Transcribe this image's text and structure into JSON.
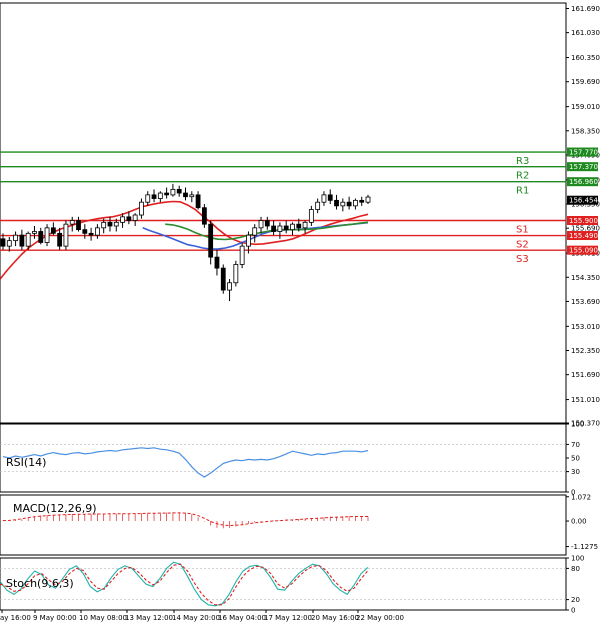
{
  "chart_data": [
    {
      "type": "candlestick",
      "panel": "price",
      "ylim": [
        150.37,
        161.84
      ],
      "y_ticks": [
        "161.690",
        "161.030",
        "160.350",
        "159.690",
        "159.010",
        "158.350",
        "157.690",
        "157.010",
        "156.350",
        "155.690",
        "155.010",
        "154.350",
        "153.690",
        "153.010",
        "152.350",
        "151.690",
        "151.010",
        "150.370"
      ],
      "current_price": 156.454,
      "current_price_label": "156.454",
      "candles": [
        [
          155.4,
          155.55,
          155.1,
          155.2
        ],
        [
          155.2,
          155.45,
          155.05,
          155.35
        ],
        [
          155.35,
          155.6,
          155.2,
          155.5
        ],
        [
          155.5,
          155.65,
          155.1,
          155.2
        ],
        [
          155.2,
          155.6,
          155.1,
          155.55
        ],
        [
          155.55,
          155.75,
          155.4,
          155.6
        ],
        [
          155.6,
          155.7,
          155.25,
          155.3
        ],
        [
          155.3,
          155.8,
          155.2,
          155.7
        ],
        [
          155.7,
          155.85,
          155.5,
          155.55
        ],
        [
          155.55,
          155.7,
          155.1,
          155.2
        ],
        [
          155.2,
          155.9,
          155.1,
          155.8
        ],
        [
          155.8,
          156.0,
          155.6,
          155.9
        ],
        [
          155.9,
          156.0,
          155.6,
          155.65
        ],
        [
          155.65,
          155.8,
          155.4,
          155.55
        ],
        [
          155.55,
          155.7,
          155.35,
          155.5
        ],
        [
          155.5,
          155.8,
          155.4,
          155.7
        ],
        [
          155.7,
          155.95,
          155.55,
          155.85
        ],
        [
          155.85,
          156.0,
          155.6,
          155.75
        ],
        [
          155.75,
          155.95,
          155.6,
          155.85
        ],
        [
          155.85,
          156.1,
          155.7,
          156.0
        ],
        [
          156.0,
          156.15,
          155.8,
          155.9
        ],
        [
          155.9,
          156.1,
          155.75,
          156.05
        ],
        [
          156.05,
          156.5,
          155.95,
          156.4
        ],
        [
          156.4,
          156.7,
          156.3,
          156.6
        ],
        [
          156.6,
          156.75,
          156.4,
          156.5
        ],
        [
          156.5,
          156.7,
          156.4,
          156.65
        ],
        [
          156.65,
          156.8,
          156.5,
          156.6
        ],
        [
          156.6,
          156.9,
          156.55,
          156.75
        ],
        [
          156.75,
          156.85,
          156.55,
          156.65
        ],
        [
          156.65,
          156.8,
          156.45,
          156.55
        ],
        [
          156.55,
          156.7,
          156.4,
          156.6
        ],
        [
          156.6,
          156.7,
          156.2,
          156.25
        ],
        [
          156.25,
          156.35,
          155.7,
          155.8
        ],
        [
          155.8,
          155.9,
          154.7,
          154.9
        ],
        [
          154.9,
          155.1,
          154.4,
          154.6
        ],
        [
          154.6,
          154.7,
          153.9,
          154.0
        ],
        [
          154.0,
          154.3,
          153.7,
          154.2
        ],
        [
          154.2,
          154.8,
          154.1,
          154.7
        ],
        [
          154.7,
          155.3,
          154.6,
          155.2
        ],
        [
          155.2,
          155.6,
          155.0,
          155.5
        ],
        [
          155.5,
          155.8,
          155.3,
          155.7
        ],
        [
          155.7,
          156.0,
          155.55,
          155.9
        ],
        [
          155.9,
          156.0,
          155.65,
          155.75
        ],
        [
          155.75,
          155.9,
          155.5,
          155.6
        ],
        [
          155.6,
          155.85,
          155.4,
          155.75
        ],
        [
          155.75,
          155.9,
          155.55,
          155.65
        ],
        [
          155.65,
          155.85,
          155.5,
          155.8
        ],
        [
          155.8,
          155.95,
          155.6,
          155.7
        ],
        [
          155.7,
          155.9,
          155.55,
          155.85
        ],
        [
          155.85,
          156.3,
          155.75,
          156.2
        ],
        [
          156.2,
          156.5,
          156.1,
          156.4
        ],
        [
          156.4,
          156.7,
          156.3,
          156.6
        ],
        [
          156.6,
          156.75,
          156.35,
          156.45
        ],
        [
          156.45,
          156.6,
          156.2,
          156.3
        ],
        [
          156.3,
          156.5,
          156.15,
          156.4
        ],
        [
          156.4,
          156.55,
          156.2,
          156.3
        ],
        [
          156.3,
          156.5,
          156.2,
          156.45
        ],
        [
          156.45,
          156.55,
          156.3,
          156.4
        ],
        [
          156.4,
          156.6,
          156.35,
          156.54
        ]
      ],
      "levels": [
        {
          "name": "R3",
          "value": 157.77,
          "label": "157.770",
          "color": "#1f8a1f"
        },
        {
          "name": "R2",
          "value": 157.37,
          "label": "157.370",
          "color": "#1f8a1f"
        },
        {
          "name": "R1",
          "value": 156.96,
          "label": "156.960",
          "color": "#1f8a1f"
        },
        {
          "name": "S1",
          "value": 155.9,
          "label": "155.900",
          "color": "#e02020"
        },
        {
          "name": "S2",
          "value": 155.49,
          "label": "155.490",
          "color": "#e02020"
        },
        {
          "name": "S3",
          "value": 155.09,
          "label": "155.090",
          "color": "#e02020"
        }
      ],
      "moving_averages": [
        {
          "color": "#e02020",
          "values": [
            154.3,
            154.55,
            154.78,
            155.0,
            155.18,
            155.33,
            155.46,
            155.57,
            155.66,
            155.73,
            155.8,
            155.86,
            155.91,
            155.95,
            155.98,
            156.0,
            156.05,
            156.12,
            156.2,
            156.28,
            156.33,
            156.37,
            156.4,
            156.42,
            156.41,
            156.32,
            156.2,
            156.02,
            155.86,
            155.67,
            155.51,
            155.39,
            155.31,
            155.27,
            155.25,
            155.26,
            155.29,
            155.32,
            155.35,
            155.4,
            155.48,
            155.57,
            155.66,
            155.73,
            155.8,
            155.86,
            155.91,
            155.96,
            156.02,
            156.07
          ]
        },
        {
          "color": "#3a5fd6",
          "values": [
            155.7,
            155.62,
            155.55,
            155.48,
            155.4,
            155.32,
            155.24,
            155.2,
            155.15,
            155.12,
            155.12,
            155.15,
            155.2,
            155.28,
            155.36,
            155.45,
            155.54,
            155.6,
            155.63,
            155.64,
            155.65,
            155.66,
            155.68,
            155.7,
            155.72,
            155.74,
            155.76,
            155.78,
            155.8,
            155.82,
            155.84
          ]
        },
        {
          "color": "#2e8b2e",
          "values": [
            155.8,
            155.78,
            155.73,
            155.66,
            155.57,
            155.49,
            155.43,
            155.39,
            155.38,
            155.4,
            155.44,
            155.49,
            155.54,
            155.58,
            155.62,
            155.64,
            155.65,
            155.65,
            155.65,
            155.66,
            155.67,
            155.69,
            155.72,
            155.75,
            155.78,
            155.8,
            155.83,
            155.85
          ]
        }
      ]
    },
    {
      "type": "line",
      "panel": "rsi",
      "title": "RSI(14)",
      "ylim": [
        0,
        100
      ],
      "y_ticks": [
        "100",
        "70",
        "50",
        "30",
        "0"
      ],
      "y_tick_values": [
        100,
        70,
        50,
        30,
        0
      ],
      "series": [
        {
          "color": "#4a90e2",
          "values": [
            52,
            50,
            53,
            51,
            53,
            55,
            53,
            56,
            58,
            56,
            55,
            57,
            58,
            56,
            57,
            59,
            60,
            61,
            60,
            62,
            63,
            64,
            65,
            64,
            65,
            63,
            62,
            60,
            57,
            48,
            37,
            28,
            22,
            28,
            35,
            42,
            45,
            47,
            46,
            48,
            47,
            48,
            47,
            49,
            52,
            56,
            60,
            58,
            56,
            54,
            56,
            55,
            57,
            58,
            60,
            60,
            60,
            59,
            61
          ]
        }
      ]
    },
    {
      "type": "macd",
      "panel": "macd",
      "title": "MACD(12,26,9)",
      "ylim": [
        -1.5,
        1.15
      ],
      "y_ticks": [
        "1.072",
        "0.00",
        "-1.1275"
      ],
      "y_tick_values": [
        1.072,
        0,
        -1.1275
      ],
      "histogram": [
        0.02,
        0.02,
        0.04,
        0.08,
        0.14,
        0.2,
        0.24,
        0.26,
        0.28,
        0.29,
        0.3,
        0.31,
        0.31,
        0.31,
        0.32,
        0.32,
        0.32,
        0.32,
        0.32,
        0.33,
        0.33,
        0.34,
        0.35,
        0.36,
        0.36,
        0.37,
        0.37,
        0.38,
        0.38,
        0.36,
        0.3,
        0.16,
        -0.02,
        -0.2,
        -0.3,
        -0.32,
        -0.3,
        -0.24,
        -0.18,
        -0.12,
        -0.06,
        -0.03,
        -0.01,
        0.01,
        0.03,
        0.05,
        0.07,
        0.09,
        0.11,
        0.13,
        0.15,
        0.17,
        0.19,
        0.2,
        0.21,
        0.22,
        0.22,
        0.21,
        0.2
      ],
      "signal": [
        0.02,
        0.03,
        0.06,
        0.1,
        0.15,
        0.19,
        0.22,
        0.24,
        0.26,
        0.27,
        0.28,
        0.29,
        0.3,
        0.3,
        0.31,
        0.31,
        0.31,
        0.32,
        0.32,
        0.32,
        0.32,
        0.33,
        0.33,
        0.34,
        0.34,
        0.35,
        0.35,
        0.36,
        0.36,
        0.35,
        0.32,
        0.24,
        0.12,
        -0.02,
        -0.12,
        -0.18,
        -0.2,
        -0.19,
        -0.16,
        -0.12,
        -0.08,
        -0.05,
        -0.02,
        0.0,
        0.02,
        0.04,
        0.05,
        0.07,
        0.09,
        0.11,
        0.12,
        0.14,
        0.16,
        0.17,
        0.18,
        0.19,
        0.2,
        0.2,
        0.2
      ],
      "colors": {
        "histogram": "#e02020",
        "signal": "#e02020"
      }
    },
    {
      "type": "line",
      "panel": "stoch",
      "title": "Stoch(9,6,3)",
      "ylim": [
        0,
        100
      ],
      "y_ticks": [
        "100",
        "80",
        "20",
        "0"
      ],
      "y_tick_values": [
        100,
        80,
        20,
        0
      ],
      "series": [
        {
          "color": "#20b2aa",
          "values": [
            55,
            38,
            30,
            40,
            60,
            75,
            68,
            48,
            42,
            60,
            78,
            85,
            70,
            45,
            35,
            42,
            62,
            78,
            85,
            80,
            65,
            50,
            45,
            60,
            80,
            92,
            88,
            65,
            40,
            20,
            10,
            8,
            12,
            30,
            55,
            75,
            84,
            86,
            80,
            62,
            40,
            38,
            55,
            70,
            80,
            88,
            85,
            70,
            50,
            38,
            30,
            48,
            70,
            82
          ]
        },
        {
          "color": "#e02020",
          "dashed": true,
          "values": [
            50,
            45,
            36,
            38,
            50,
            66,
            70,
            58,
            48,
            55,
            70,
            80,
            76,
            56,
            42,
            40,
            55,
            70,
            80,
            82,
            72,
            58,
            48,
            55,
            72,
            86,
            88,
            75,
            52,
            32,
            18,
            10,
            10,
            22,
            45,
            65,
            78,
            84,
            82,
            70,
            50,
            42,
            50,
            64,
            76,
            84,
            85,
            76,
            58,
            44,
            36,
            42,
            60,
            76
          ]
        }
      ]
    }
  ],
  "x_axis": {
    "tick_labels": [
      "ay 16:00",
      "9 May 00:00",
      "10 May 08:00",
      "13 May 12:00",
      "14 May 20:00",
      "16 May 04:00",
      "17 May 12:00",
      "20 May 16:00",
      "22 May 00:00"
    ]
  }
}
